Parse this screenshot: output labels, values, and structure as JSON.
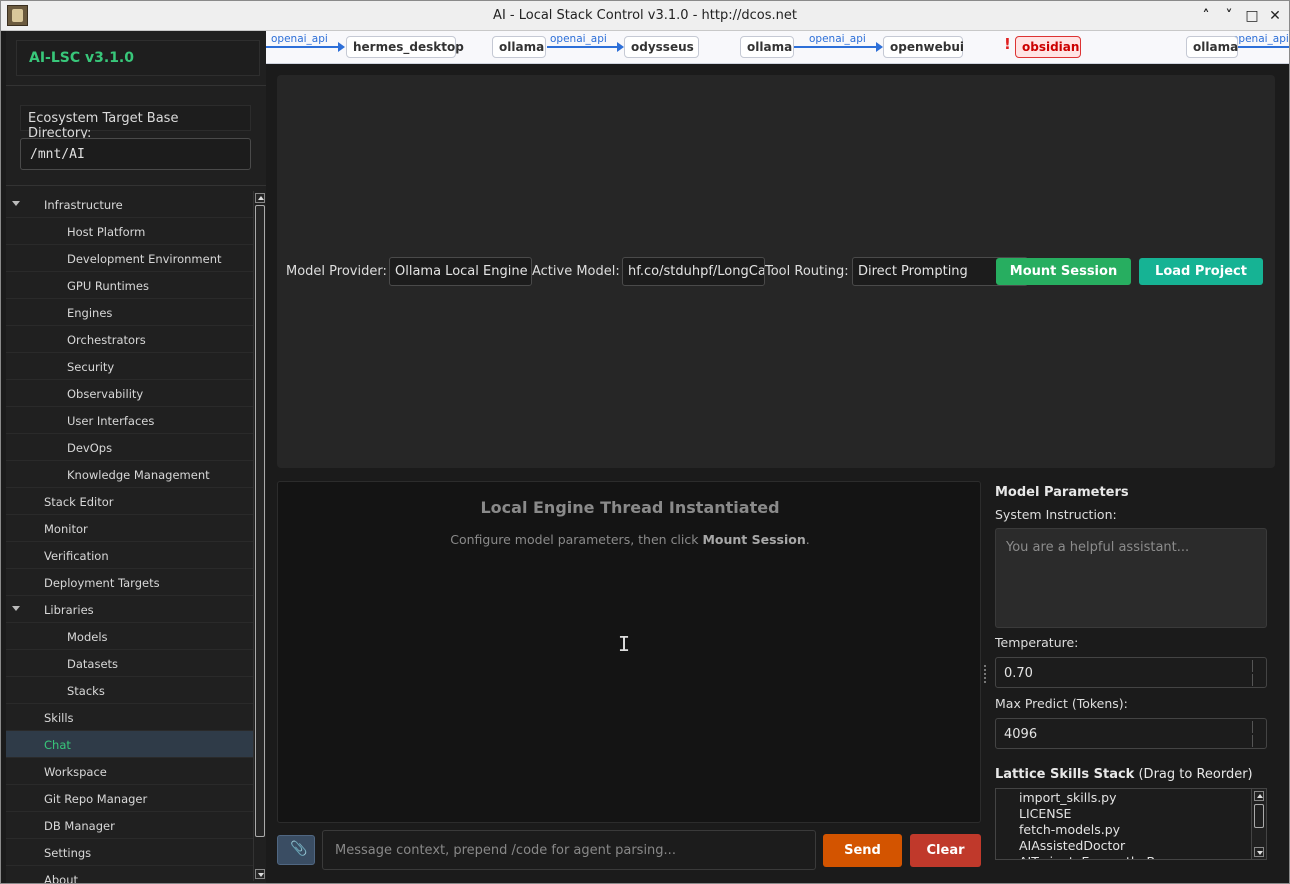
{
  "window": {
    "title": "AI - Local Stack Control v3.1.0 - http://dcos.net",
    "minimize_glyph": "˄",
    "restore_glyph": "˅",
    "maximize_glyph": "□",
    "close_glyph": "✕"
  },
  "sidebar": {
    "brand": "AI-LSC v3.1.0",
    "base_dir_label": "Ecosystem Target Base Directory:",
    "base_dir_value": "/mnt/AI",
    "items": [
      {
        "label": "Infrastructure",
        "level": 0,
        "expandable": true
      },
      {
        "label": "Host Platform",
        "level": 1
      },
      {
        "label": "Development Environment",
        "level": 1
      },
      {
        "label": "GPU Runtimes",
        "level": 1
      },
      {
        "label": "Engines",
        "level": 1
      },
      {
        "label": "Orchestrators",
        "level": 1
      },
      {
        "label": "Security",
        "level": 1
      },
      {
        "label": "Observability",
        "level": 1
      },
      {
        "label": "User Interfaces",
        "level": 1
      },
      {
        "label": "DevOps",
        "level": 1
      },
      {
        "label": "Knowledge Management",
        "level": 1
      },
      {
        "label": "Stack Editor",
        "level": 0
      },
      {
        "label": "Monitor",
        "level": 0
      },
      {
        "label": "Verification",
        "level": 0
      },
      {
        "label": "Deployment Targets",
        "level": 0
      },
      {
        "label": "Libraries",
        "level": 0,
        "expandable": true
      },
      {
        "label": "Models",
        "level": 1
      },
      {
        "label": "Datasets",
        "level": 1
      },
      {
        "label": "Stacks",
        "level": 1
      },
      {
        "label": "Skills",
        "level": 0
      },
      {
        "label": "Chat",
        "level": 0,
        "selected": true
      },
      {
        "label": "Workspace",
        "level": 0
      },
      {
        "label": "Git Repo Manager",
        "level": 0
      },
      {
        "label": "DB Manager",
        "level": 0
      },
      {
        "label": "Settings",
        "level": 0
      },
      {
        "label": "About",
        "level": 0
      }
    ]
  },
  "graph": {
    "edge_label": "openai_api",
    "nodes": [
      "hermes_desktop",
      "ollama",
      "odysseus",
      "ollama",
      "openwebui",
      "obsidian",
      "ollama"
    ],
    "error_glyph": "!"
  },
  "toolbar": {
    "provider_label": "Model Provider:",
    "provider_value": "Ollama Local Engine",
    "model_label": "Active Model:",
    "model_value": "hf.co/stduhpf/LongCa",
    "routing_label": "Tool Routing:",
    "routing_value": "Direct Prompting",
    "mount_label": "Mount Session",
    "load_label": "Load Project"
  },
  "chat": {
    "title": "Local Engine Thread Instantiated",
    "subtitle_pre": "Configure model parameters, then click ",
    "subtitle_bold": "Mount Session",
    "subtitle_post": ".",
    "cursor_glyph": "I",
    "attach_glyph": "📎",
    "input_placeholder": "Message context, prepend /code for agent parsing...",
    "send_label": "Send",
    "clear_label": "Clear"
  },
  "params": {
    "title": "Model Parameters",
    "system_label": "System Instruction:",
    "system_placeholder": "You are a helpful assistant...",
    "temperature_label": "Temperature:",
    "temperature_value": "0.70",
    "max_predict_label": "Max Predict (Tokens):",
    "max_predict_value": "4096",
    "skills_title": "Lattice Skills Stack",
    "skills_hint": "(Drag to Reorder)",
    "skills": [
      "import_skills.py",
      "LICENSE",
      "fetch-models.py",
      "AIAssistedDoctor",
      "AITryingtoEscapetheBox"
    ]
  },
  "colors": {
    "accent_green": "#38c77a",
    "mount_green": "#27ae60",
    "load_teal": "#16b394",
    "send_orange": "#d35400",
    "clear_red": "#c0392b",
    "edge_blue": "#2d6fd8",
    "error_red": "#e02020"
  }
}
